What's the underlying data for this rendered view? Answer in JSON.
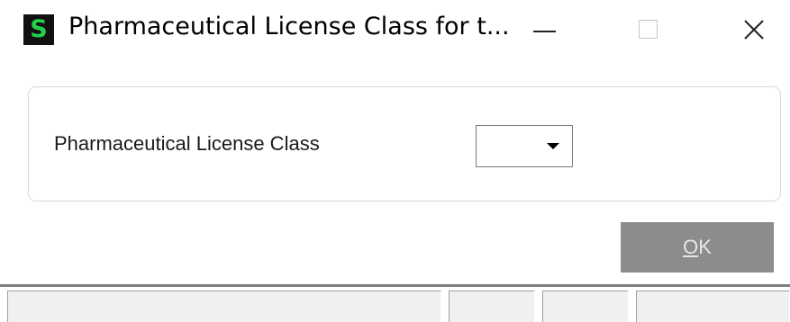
{
  "window": {
    "title": "Pharmaceutical License Class for t...",
    "app_icon_letter": "S",
    "app_icon_color": "#22d14a",
    "controls": [
      "minimize-icon",
      "maximize-icon",
      "close-icon"
    ]
  },
  "form": {
    "field_label": "Pharmaceutical License Class",
    "combo_value": ""
  },
  "buttons": {
    "ok_mnemonic": "O",
    "ok_rest": "K"
  },
  "statusbar": {
    "panes": [
      "",
      "",
      "",
      ""
    ]
  }
}
